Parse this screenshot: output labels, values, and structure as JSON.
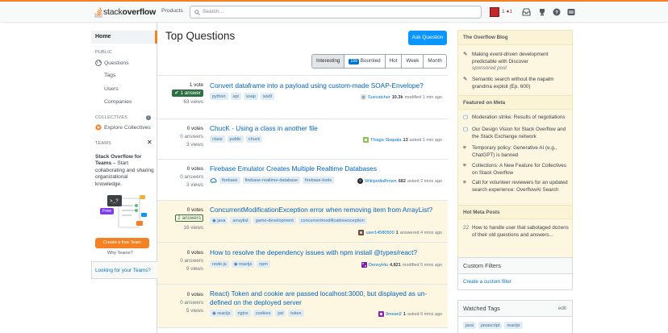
{
  "header": {
    "logo_text_light": "stack",
    "logo_text_bold": "overflow",
    "products": "Products",
    "search_placeholder": "Search...",
    "reputation": "1",
    "badge": "1"
  },
  "nav": {
    "home": "Home",
    "public_label": "PUBLIC",
    "questions": "Questions",
    "tags": "Tags",
    "users": "Users",
    "companies": "Companies",
    "collectives_label": "COLLECTIVES",
    "explore_collectives": "Explore Collectives",
    "teams_label": "TEAMS",
    "teams_title": "Stack Overflow for Teams",
    "teams_desc": " – Start collaborating and sharing organizational knowledge.",
    "free_badge": "Free",
    "create_team": "Create a free Team",
    "why_teams": "Why Teams?",
    "looking": "Looking for your Teams?"
  },
  "main": {
    "title": "Top Questions",
    "ask_button": "Ask Question",
    "filters": [
      "Interesting",
      "Bountied",
      "Hot",
      "Week",
      "Month"
    ],
    "bounty_count": "199",
    "questions": [
      {
        "votes": "1 vote",
        "answers": "1 answer",
        "views": "63 views",
        "title": "Convert dataframe into a payload using custom-made SOAP-Envelope?",
        "tags": [
          "python",
          "api",
          "soap",
          "wsdl"
        ],
        "user": "Suncatcher",
        "rep": "10.3k",
        "action": "modified 1 min ago"
      },
      {
        "votes": "0 votes",
        "answers": "0 answers",
        "views": "3 views",
        "title": "ChucK - Using a class in another file",
        "tags": [
          "class",
          "public",
          "chuck"
        ],
        "user": "Thiago Skapata",
        "rep": "13",
        "action": "asked 1 min ago"
      },
      {
        "votes": "0 votes",
        "answers": "0 answers",
        "views": "3 views",
        "title": "Firebase Emulator Creates Multiple Realtime Databases",
        "tags": [
          "firebase",
          "firebase-realtime-database",
          "firebase-tools"
        ],
        "user": "WikipediaBrown",
        "rep": "682",
        "action": "asked 2 mins ago"
      },
      {
        "votes": "0 votes",
        "answers": "2 answers",
        "views": "16 views",
        "title": "ConcurrentModificationException error when removing item from ArrayList?",
        "tags": [
          "java",
          "arraylist",
          "game-development",
          "concurrentmodificationexception"
        ],
        "user": "user14580500",
        "rep": "1",
        "action": "answered 4 mins ago"
      },
      {
        "votes": "0 votes",
        "answers": "0 answers",
        "views": "9 views",
        "title": "How to resolve the dependency issues with npm install @types/react?",
        "tags": [
          "node.js",
          "reactjs",
          "npm"
        ],
        "user": "DennyHiu",
        "rep": "4,821",
        "action": "modified 5 mins ago"
      },
      {
        "votes": "0 votes",
        "answers": "0 answers",
        "views": "5 views",
        "title": "React) Token and cookie are passed localhost:3000, but displayed as un-defined on the deployed server",
        "tags": [
          "reactjs",
          "nginx",
          "cookies",
          "jwt",
          "token"
        ],
        "user": "9mean2",
        "rep": "1",
        "action": "asked 6 mins ago"
      }
    ]
  },
  "sidebar": {
    "blog_title": "The Overflow Blog",
    "blog_items": [
      "Making event-driven development predictable with Discover",
      "Semantic search without the napalm grandma exploit (Ep. 600)"
    ],
    "sponsored": "sponsored post",
    "meta_title": "Featured on Meta",
    "meta_items": [
      "Moderation strike: Results of negotiations",
      "Our Design Vision for Stack Overflow and the Stack Exchange network",
      "Temporary policy: Generative AI (e.g., ChatGPT) is banned",
      "Collections: A New Feature for Collectives on Stack Overflow",
      "Call for volunteer reviewers for an updated search experience: OverflowAI Search"
    ],
    "hot_title": "Hot Meta Posts",
    "hot_count": "22",
    "hot_item": "How to handle user that sabotaged dozens of their old questions and answers...",
    "custom_filters_title": "Custom Filters",
    "create_filter": "Create a custom filter",
    "watched_tags_title": "Watched Tags",
    "edit": "edit",
    "watched_tags": [
      "java",
      "javascript",
      "reactjs"
    ]
  },
  "colors": {
    "accent": "#f48225",
    "link": "#0063bf",
    "primary": "#0a95ff",
    "accepted": "#2f6f44",
    "watched_bg": "#fdf7e2"
  }
}
